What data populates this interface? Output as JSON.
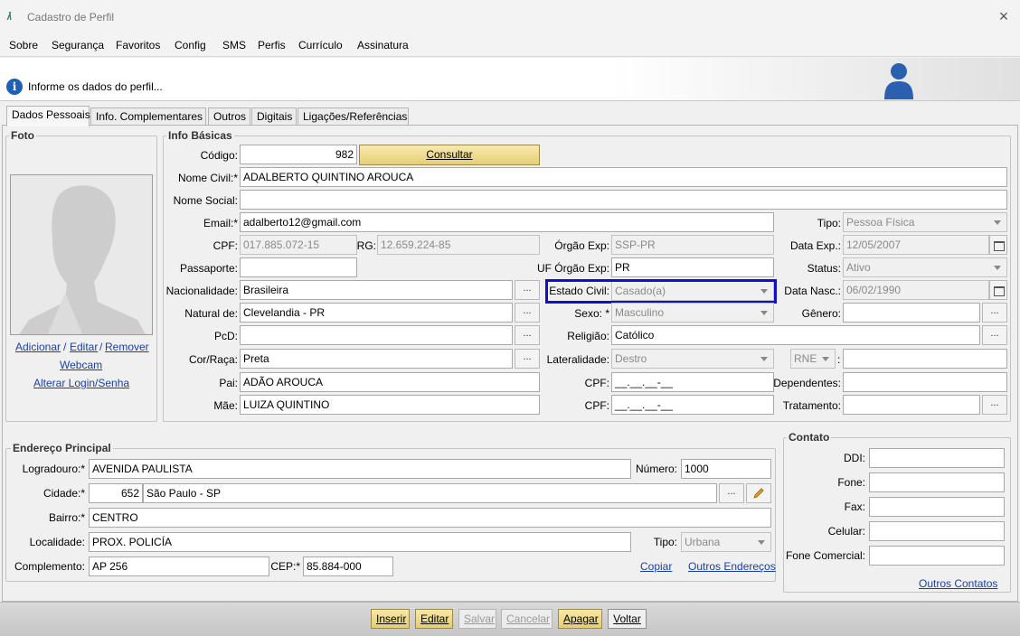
{
  "window": {
    "title": "Cadastro de Perfil",
    "icon": "app-logo-icon",
    "close": "×"
  },
  "menu": [
    "Sobre",
    "Segurança",
    "Favoritos",
    "Config",
    "SMS",
    "Perfis",
    "Currículo",
    "Assinatura"
  ],
  "header": {
    "message": "Informe os dados do perfil..."
  },
  "tabs": [
    "Dados Pessoais",
    "Info. Complementares",
    "Outros",
    "Digitais",
    "Ligações/Referências"
  ],
  "foto": {
    "title": "Foto",
    "links": {
      "adicionar": "Adicionar",
      "sep1": "/",
      "editar": "Editar",
      "sep2": "/",
      "remover": "Remover",
      "webcam": "Webcam",
      "alterar": "Alterar Login/Senha"
    }
  },
  "info": {
    "title": "Info Básicas",
    "codigo_label": "Código:",
    "codigo": "982",
    "consultar": "Consultar",
    "nome_civil_label": "Nome Civil:*",
    "nome_civil": "ADALBERTO QUINTINO AROUCA",
    "nome_social_label": "Nome Social:",
    "nome_social": "",
    "email_label": "Email:*",
    "email": "adalberto12@gmail.com",
    "cpf_label": "CPF:",
    "cpf": "017.885.072-15",
    "rg_label": "RG:",
    "rg": "12.659.224-85",
    "passaporte_label": "Passaporte:",
    "passaporte": "",
    "nacionalidade_label": "Nacionalidade:",
    "nacionalidade": "Brasileira",
    "natural_label": "Natural de:",
    "natural": "Clevelandia - PR",
    "pcd_label": "PcD:",
    "pcd": "",
    "cor_label": "Cor/Raça:",
    "cor": "Preta",
    "pai_label": "Pai:",
    "pai": "ADÃO AROUCA",
    "mae_label": "Mãe:",
    "mae": "LUIZA QUINTINO",
    "orgao_label": "Órgão Exp:",
    "orgao": "SSP-PR",
    "uf_orgao_label": "UF Órgão Exp:",
    "uf_orgao": "PR",
    "estado_civil_label": "Estado Civil:",
    "estado_civil": "Casado(a)",
    "sexo_label": "Sexo: *",
    "sexo": "Masculino",
    "religiao_label": "Religião:",
    "religiao": "Católico",
    "lateralidade_label": "Lateralidade:",
    "lateralidade": "Destro",
    "cpf_pai_label": "CPF:",
    "cpf_pai": "__.__.__-__",
    "cpf_mae_label": "CPF:",
    "cpf_mae": "__.__.__-__",
    "tipo_label": "Tipo:",
    "tipo": "Pessoa Física",
    "data_exp_label": "Data Exp.:",
    "data_exp": "12/05/2007",
    "status_label": "Status:",
    "status": "Ativo",
    "data_nasc_label": "Data Nasc.:",
    "data_nasc": "06/02/1990",
    "genero_label": "Gênero:",
    "genero": "",
    "rne": "RNE",
    "rne_colon": ":",
    "dependentes_label": "Dependentes:",
    "dependentes": "",
    "tratamento_label": "Tratamento:",
    "tratamento": "",
    "ellipsis": "..."
  },
  "endereco": {
    "title": "Endereço Principal",
    "logradouro_label": "Logradouro:*",
    "logradouro": "AVENIDA PAULISTA",
    "numero_label": "Número:",
    "numero": "1000",
    "cidade_label": "Cidade:*",
    "cidade_cod": "652",
    "cidade": "São Paulo - SP",
    "bairro_label": "Bairro:*",
    "bairro": "CENTRO",
    "localidade_label": "Localidade:",
    "localidade": "PROX. POLICÍA",
    "tipo_label": "Tipo:",
    "tipo": "Urbana",
    "complemento_label": "Complemento:",
    "complemento": "AP 256",
    "cep_label": "CEP:*",
    "cep": "85.884-000",
    "copiar": "Copiar",
    "outros": "Outros Endereços"
  },
  "contato": {
    "title": "Contato",
    "ddi_label": "DDI:",
    "fone_label": "Fone:",
    "fax_label": "Fax:",
    "celular_label": "Celular:",
    "fone_comercial_label": "Fone Comercial:",
    "outros": "Outros Contatos"
  },
  "buttons": {
    "inserir": "Inserir",
    "editar": "Editar",
    "salvar": "Salvar",
    "cancelar": "Cancelar",
    "apagar": "Apagar",
    "voltar": "Voltar"
  },
  "colors": {
    "highlight": "#1010c8",
    "gold": "#e6cf75",
    "link": "#1a3fa8"
  }
}
